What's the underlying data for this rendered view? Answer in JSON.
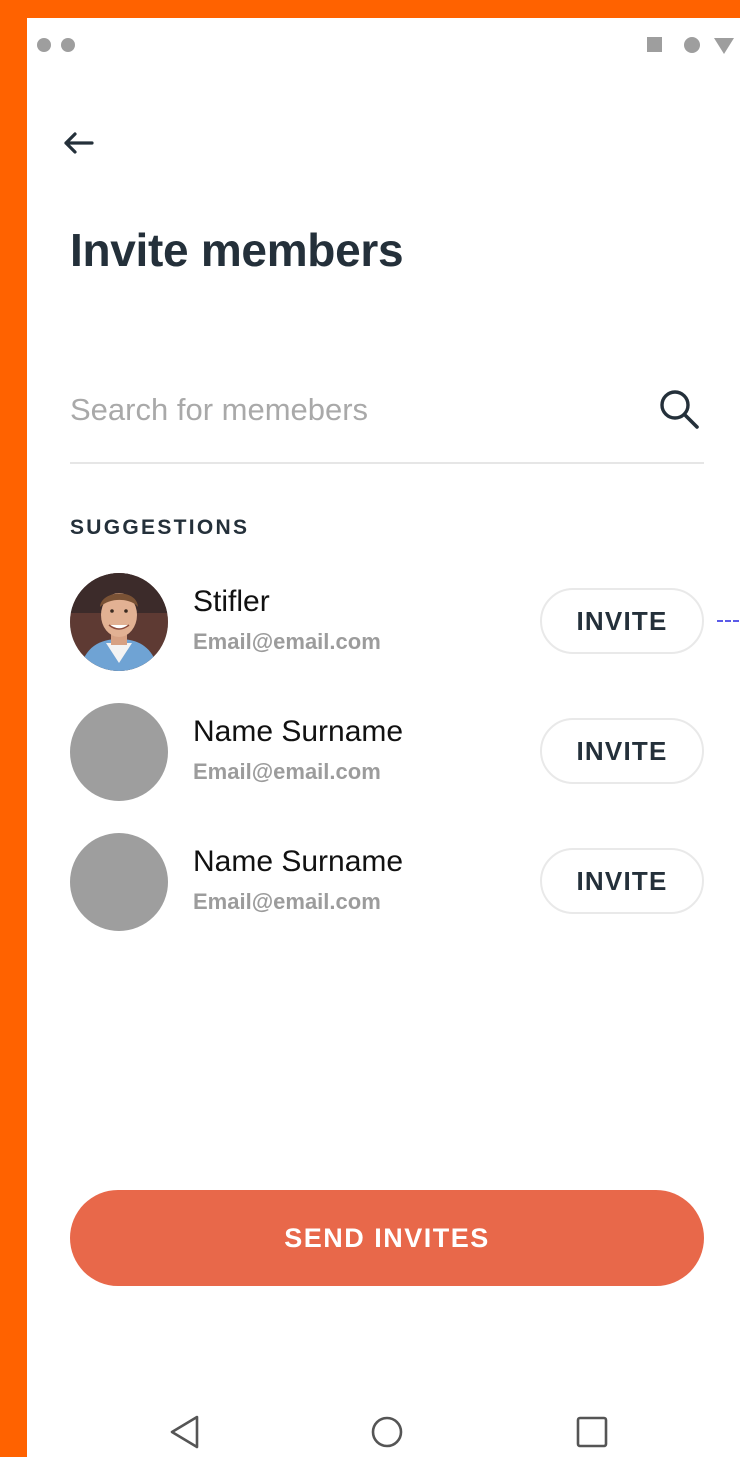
{
  "title": "Invite members",
  "search": {
    "placeholder": "Search for memebers",
    "value": ""
  },
  "suggestions_label": "SUGGESTIONS",
  "members": [
    {
      "name": "Stifler",
      "email": "Email@email.com",
      "invite_label": "INVITE"
    },
    {
      "name": "Name Surname",
      "email": "Email@email.com",
      "invite_label": "INVITE"
    },
    {
      "name": "Name Surname",
      "email": "Email@email.com",
      "invite_label": "INVITE"
    }
  ],
  "send_label": "SEND INVITES",
  "icons": {
    "back": "arrow-left-icon",
    "search": "search-icon",
    "nav_back": "triangle-back-icon",
    "nav_home": "circle-home-icon",
    "nav_recent": "square-recents-icon"
  },
  "colors": {
    "frame": "#FF6200",
    "title": "#24303A",
    "primary_button": "#E8684A",
    "avatar_placeholder": "#9E9E9E",
    "muted_text": "#9C9C9C"
  }
}
